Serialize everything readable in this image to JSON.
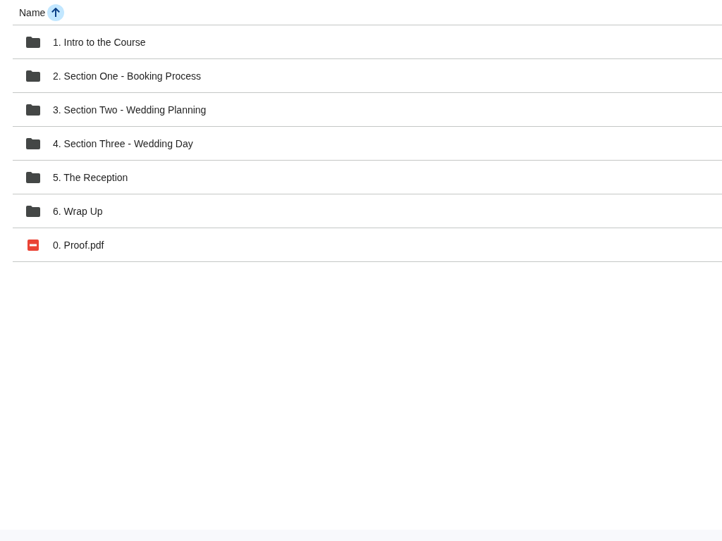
{
  "header": {
    "column": "Name"
  },
  "files": [
    {
      "kind": "folder",
      "name": "1. Intro to the Course"
    },
    {
      "kind": "folder",
      "name": "2. Section One - Booking Process"
    },
    {
      "kind": "folder",
      "name": "3. Section Two - Wedding Planning"
    },
    {
      "kind": "folder",
      "name": "4. Section Three - Wedding Day"
    },
    {
      "kind": "folder",
      "name": "5. The Reception"
    },
    {
      "kind": "folder",
      "name": "6. Wrap Up"
    },
    {
      "kind": "pdf",
      "name": "0. Proof.pdf"
    }
  ]
}
